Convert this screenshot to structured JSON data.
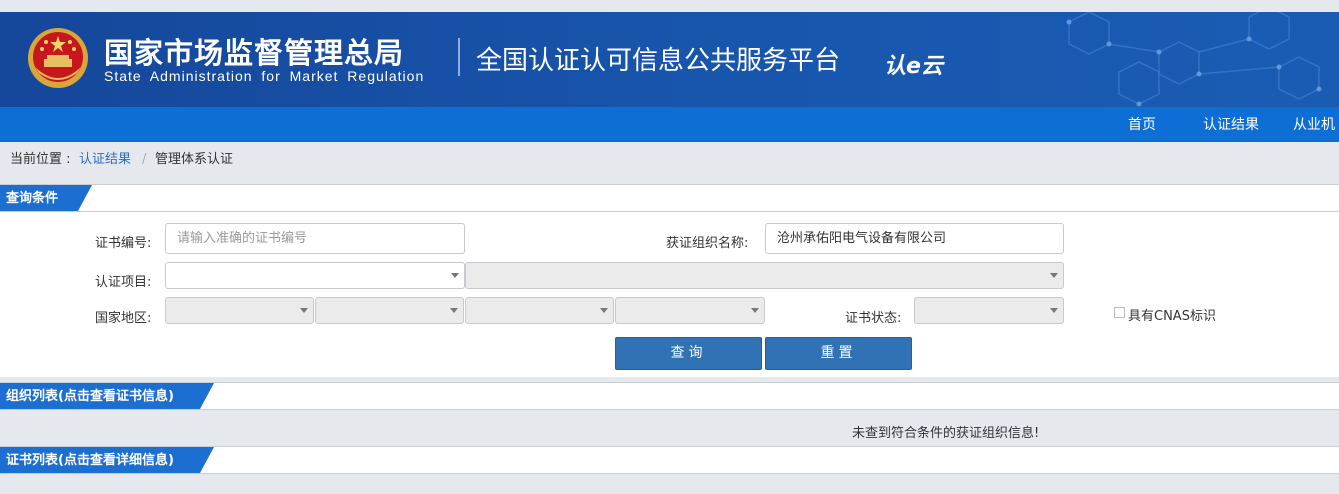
{
  "header": {
    "agency_name_cn": "国家市场监督管理总局",
    "agency_name_en": "State Administration for Market Regulation",
    "platform_name": "全国认证认可信息公共服务平台",
    "platform_logo_text": "认e云"
  },
  "nav": {
    "items": [
      "首页",
      "认证结果",
      "从业机"
    ]
  },
  "breadcrumb": {
    "prefix": "当前位置 :",
    "level1": "认证结果",
    "separator": "/",
    "level2": "管理体系认证"
  },
  "query": {
    "section_title": "查询条件",
    "cert_no_label": "证书编号:",
    "cert_no_placeholder": "请输入准确的证书编号",
    "org_name_label": "获证组织名称:",
    "org_name_value": "沧州承佑阳电气设备有限公司",
    "project_label": "认证项目:",
    "region_label": "国家地区:",
    "status_label": "证书状态:",
    "cnas_label": "具有CNAS标识",
    "search_button": "查询",
    "reset_button": "重置"
  },
  "org_list": {
    "section_title": "组织列表(点击查看证书信息)",
    "empty_message": "未查到符合条件的获证组织信息!"
  },
  "cert_list": {
    "section_title": "证书列表(点击查看详细信息)"
  },
  "colors": {
    "banner": "#1856ad",
    "navbar": "#0d6fd6",
    "section_tab": "#1c6fd0",
    "button": "#3172b4",
    "link": "#2d6fc0"
  }
}
